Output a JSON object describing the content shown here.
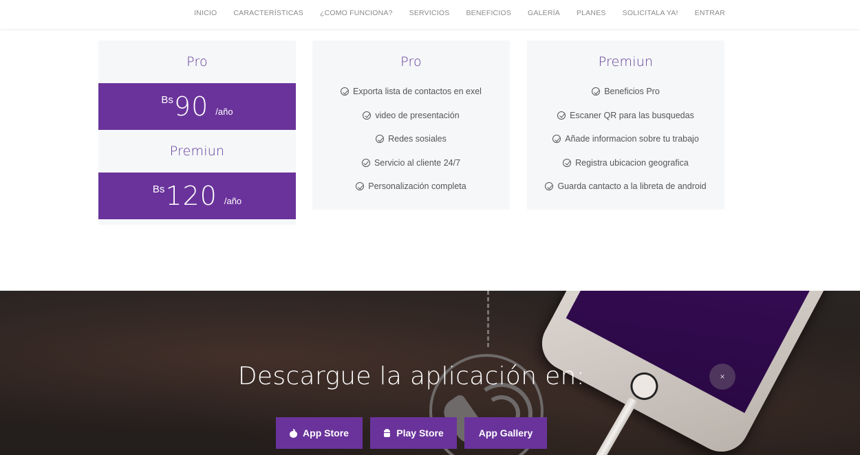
{
  "nav": {
    "items": [
      "INICIO",
      "CARACTERÍSTICAS",
      "¿COMO FUNCIONA?",
      "SERVICIOS",
      "BENEFICIOS",
      "GALERÍA",
      "PLANES",
      "SOLICITALA YA!",
      "ENTRAR"
    ]
  },
  "pricing": {
    "plans": [
      {
        "name": "Pro",
        "currency": "Bs",
        "amount": "90",
        "period": "/año"
      },
      {
        "name": "Premiun",
        "currency": "Bs",
        "amount": "120",
        "period": "/año"
      }
    ],
    "pro_features": {
      "title": "Pro",
      "items": [
        "Exporta lista de contactos en exel",
        "video de presentación",
        "Redes sosiales",
        "Servicio al cliente 24/7",
        "Personalización completa"
      ]
    },
    "premium_features": {
      "title": "Premiun",
      "items": [
        "Beneficios Pro",
        "Escaner QR para las busquedas",
        "Añade informacion sobre tu trabajo",
        "Registra ubicacion geografica",
        "Guarda cantacto a la libreta de android"
      ]
    }
  },
  "download": {
    "title": "Descargue la aplicación en:",
    "close": "×",
    "buttons": [
      {
        "label": "App Store",
        "icon": "apple-icon"
      },
      {
        "label": "Play Store",
        "icon": "android-icon"
      },
      {
        "label": "App Gallery",
        "icon": ""
      }
    ]
  },
  "colors": {
    "accent": "#6a339b",
    "title_purple": "#5f3a98",
    "card_bg": "#f6f7f9"
  }
}
